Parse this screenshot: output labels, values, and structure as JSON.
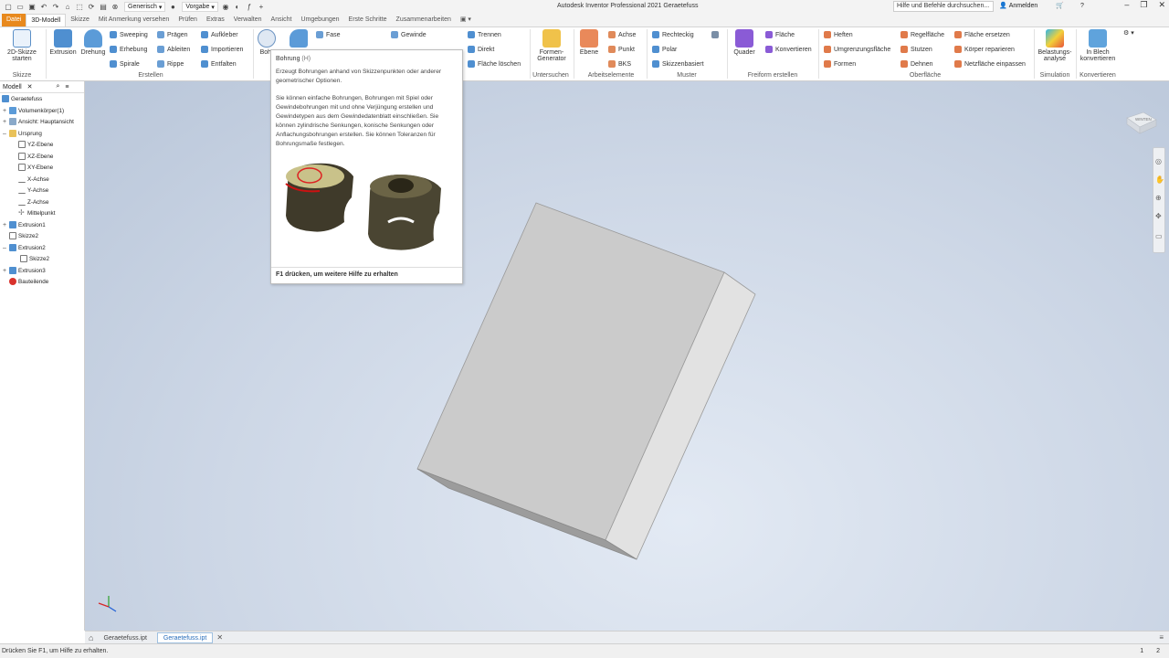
{
  "titlebar": {
    "app_title": "Autodesk Inventor Professional 2021   Geraetefuss",
    "appearance_value": "Generisch",
    "style_value": "Vorgabe",
    "help_search_placeholder": "Hilfe und Befehle durchsuchen...",
    "signin_label": "Anmelden"
  },
  "tabs": [
    "Datei",
    "3D-Modell",
    "Skizze",
    "Mit Anmerkung versehen",
    "Prüfen",
    "Extras",
    "Verwalten",
    "Ansicht",
    "Umgebungen",
    "Erste Schritte",
    "Zusammenarbeiten"
  ],
  "ribbon": {
    "skizze": {
      "big": "2D-Skizze starten",
      "panel": "Skizze"
    },
    "erstellen": {
      "panel": "Erstellen",
      "big": [
        "Extrusion",
        "Drehung"
      ],
      "small_col1": [
        "Sweeping",
        "Erhebung",
        "Spirale"
      ],
      "small_col2": [
        "Prägen",
        "Ableiten",
        "Rippe"
      ],
      "small_col3": [
        "Aufkleber",
        "Importieren",
        "Entfalten"
      ]
    },
    "aendern": {
      "bohrung": "Bohr",
      "fase": "Fase",
      "gewinde": "Gewinde"
    },
    "trennen": [
      "Trennen",
      "Direkt",
      "Fläche löschen"
    ],
    "untersuchen": {
      "big": "Formen-Generator",
      "panel": "Untersuchen"
    },
    "arbeitselemente": {
      "big": "Ebene",
      "small": [
        "Achse",
        "Punkt",
        "BKS"
      ],
      "panel": "Arbeitselemente"
    },
    "muster": {
      "small": [
        "Rechteckig",
        "Polar",
        "Skizzenbasiert"
      ],
      "panel": "Muster"
    },
    "freiform": {
      "big": "Quader",
      "small": [
        "Fläche",
        "Konvertieren"
      ],
      "panel": "Freiform erstellen"
    },
    "oberflaeche": {
      "col1": [
        "Heften",
        "Umgrenzungsfläche",
        "Formen"
      ],
      "col2": [
        "Regelfläche",
        "Stutzen",
        "Dehnen"
      ],
      "col3": [
        "Fläche ersetzen",
        "Körper reparieren",
        "Netzfläche einpassen"
      ],
      "panel": "Oberfläche"
    },
    "simulation": {
      "big": "Belastungs-analyse",
      "panel": "Simulation"
    },
    "konvertieren": {
      "big": "In Blech konvertieren",
      "panel": "Konvertieren"
    }
  },
  "tooltip": {
    "title": "Bohrung",
    "shortcut": "(H)",
    "p1": "Erzeugt Bohrungen anhand von Skizzenpunkten oder anderer geometrischer Optionen.",
    "p2": "Sie können einfache Bohrungen, Bohrungen mit Spiel oder Gewindebohrungen mit und ohne Verjüngung erstellen und Gewindetypen aus dem Gewindedatenblatt einschließen. Sie können zylindrische Senkungen, konische Senkungen oder Anflachungsbohrungen erstellen. Sie können Toleranzen für Bohrungsmaße festlegen.",
    "footer": "F1 drücken, um weitere Hilfe zu erhalten"
  },
  "browser": {
    "title": "Modell",
    "items": [
      {
        "label": "Geraetefuss",
        "icon": "part-icon"
      },
      {
        "label": "Volumenkörper(1)",
        "icon": "solid-icon"
      },
      {
        "label": "Ansicht: Hauptansicht",
        "icon": "view-icon"
      },
      {
        "label": "Ursprung",
        "icon": "folder-icon"
      },
      {
        "label": "YZ-Ebene",
        "icon": "plane-icon"
      },
      {
        "label": "XZ-Ebene",
        "icon": "plane-icon"
      },
      {
        "label": "XY-Ebene",
        "icon": "plane-icon"
      },
      {
        "label": "X-Achse",
        "icon": "axis-icon"
      },
      {
        "label": "Y-Achse",
        "icon": "axis-icon"
      },
      {
        "label": "Z-Achse",
        "icon": "axis-icon"
      },
      {
        "label": "Mittelpunkt",
        "icon": "point-icon"
      },
      {
        "label": "Extrusion1",
        "icon": "extrusion-icon"
      },
      {
        "label": "Skizze2",
        "icon": "sketch-icon"
      },
      {
        "label": "Extrusion2",
        "icon": "extrusion-icon"
      },
      {
        "label": "Skizze2",
        "icon": "sketch-icon"
      },
      {
        "label": "Extrusion3",
        "icon": "extrusion-icon"
      },
      {
        "label": "Bauteilende",
        "icon": "end-of-part-icon"
      }
    ]
  },
  "viewcube_label": "WINTEN",
  "doc_tabs": [
    "Geraetefuss.ipt",
    "Geraetefuss.ipt"
  ],
  "status": {
    "text": "Drücken Sie F1, um Hilfe zu erhalten.",
    "n1": "1",
    "n2": "2"
  },
  "colors": {
    "file_tab": "#e8891d",
    "accent_blue": "#2a6ebb",
    "body_fill": "#c9c9c9"
  }
}
